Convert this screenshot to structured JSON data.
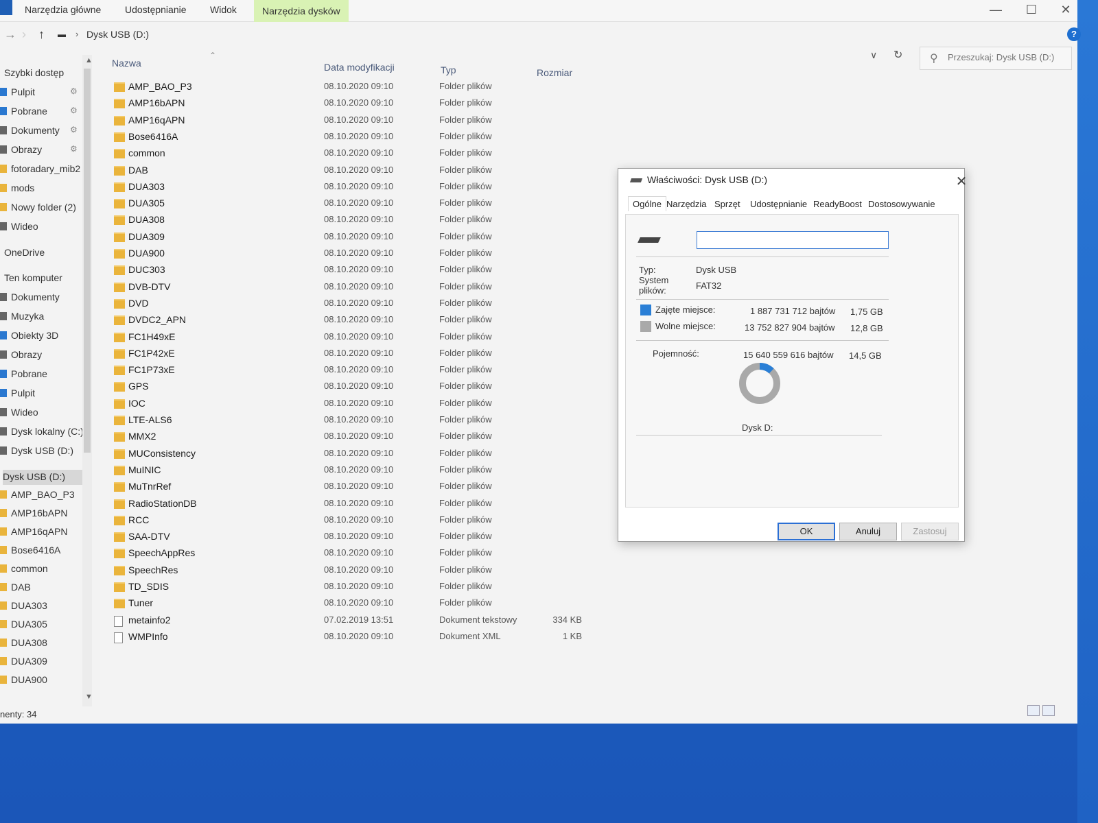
{
  "ribbon": {
    "tabs": [
      "Narzędzia główne",
      "Udostępnianie",
      "Widok"
    ],
    "tools_tab": "Narzędzia dysków"
  },
  "address": {
    "path": "Dysk USB (D:)",
    "search_placeholder": "Przeszukaj: Dysk USB (D:)"
  },
  "nav": {
    "quick_access": "Szybki dostęp",
    "items": [
      {
        "label": "Pulpit",
        "icon": "blue",
        "pinned": true
      },
      {
        "label": "Pobrane",
        "icon": "blue",
        "pinned": true
      },
      {
        "label": "Dokumenty",
        "icon": "grey",
        "pinned": true
      },
      {
        "label": "Obrazy",
        "icon": "grey",
        "pinned": true
      },
      {
        "label": "fotoradary_mib2",
        "icon": "folder",
        "pinned": false
      },
      {
        "label": "mods",
        "icon": "folder",
        "pinned": false
      },
      {
        "label": "Nowy folder (2)",
        "icon": "folder",
        "pinned": false
      },
      {
        "label": "Wideo",
        "icon": "grey",
        "pinned": false
      }
    ],
    "onedrive": "OneDrive",
    "this_pc": "Ten komputer",
    "pc_items": [
      "Dokumenty",
      "Muzyka",
      "Obiekty 3D",
      "Obrazy",
      "Pobrane",
      "Pulpit",
      "Wideo",
      "Dysk lokalny (C:)",
      "Dysk USB (D:)"
    ],
    "usb_root": "Dysk USB (D:)",
    "usb_items": [
      "AMP_BAO_P3",
      "AMP16bAPN",
      "AMP16qAPN",
      "Bose6416A",
      "common",
      "DAB",
      "DUA303",
      "DUA305",
      "DUA308",
      "DUA309",
      "DUA900"
    ]
  },
  "columns": {
    "name": "Nazwa",
    "date": "Data modyfikacji",
    "type": "Typ",
    "size": "Rozmiar"
  },
  "files": [
    {
      "name": "AMP_BAO_P3",
      "date": "08.10.2020 09:10",
      "type": "Folder plików",
      "size": "",
      "kind": "folder"
    },
    {
      "name": "AMP16bAPN",
      "date": "08.10.2020 09:10",
      "type": "Folder plików",
      "size": "",
      "kind": "folder"
    },
    {
      "name": "AMP16qAPN",
      "date": "08.10.2020 09:10",
      "type": "Folder plików",
      "size": "",
      "kind": "folder"
    },
    {
      "name": "Bose6416A",
      "date": "08.10.2020 09:10",
      "type": "Folder plików",
      "size": "",
      "kind": "folder"
    },
    {
      "name": "common",
      "date": "08.10.2020 09:10",
      "type": "Folder plików",
      "size": "",
      "kind": "folder"
    },
    {
      "name": "DAB",
      "date": "08.10.2020 09:10",
      "type": "Folder plików",
      "size": "",
      "kind": "folder"
    },
    {
      "name": "DUA303",
      "date": "08.10.2020 09:10",
      "type": "Folder plików",
      "size": "",
      "kind": "folder"
    },
    {
      "name": "DUA305",
      "date": "08.10.2020 09:10",
      "type": "Folder plików",
      "size": "",
      "kind": "folder"
    },
    {
      "name": "DUA308",
      "date": "08.10.2020 09:10",
      "type": "Folder plików",
      "size": "",
      "kind": "folder"
    },
    {
      "name": "DUA309",
      "date": "08.10.2020 09:10",
      "type": "Folder plików",
      "size": "",
      "kind": "folder"
    },
    {
      "name": "DUA900",
      "date": "08.10.2020 09:10",
      "type": "Folder plików",
      "size": "",
      "kind": "folder"
    },
    {
      "name": "DUC303",
      "date": "08.10.2020 09:10",
      "type": "Folder plików",
      "size": "",
      "kind": "folder"
    },
    {
      "name": "DVB-DTV",
      "date": "08.10.2020 09:10",
      "type": "Folder plików",
      "size": "",
      "kind": "folder"
    },
    {
      "name": "DVD",
      "date": "08.10.2020 09:10",
      "type": "Folder plików",
      "size": "",
      "kind": "folder"
    },
    {
      "name": "DVDC2_APN",
      "date": "08.10.2020 09:10",
      "type": "Folder plików",
      "size": "",
      "kind": "folder"
    },
    {
      "name": "FC1H49xE",
      "date": "08.10.2020 09:10",
      "type": "Folder plików",
      "size": "",
      "kind": "folder"
    },
    {
      "name": "FC1P42xE",
      "date": "08.10.2020 09:10",
      "type": "Folder plików",
      "size": "",
      "kind": "folder"
    },
    {
      "name": "FC1P73xE",
      "date": "08.10.2020 09:10",
      "type": "Folder plików",
      "size": "",
      "kind": "folder"
    },
    {
      "name": "GPS",
      "date": "08.10.2020 09:10",
      "type": "Folder plików",
      "size": "",
      "kind": "folder"
    },
    {
      "name": "IOC",
      "date": "08.10.2020 09:10",
      "type": "Folder plików",
      "size": "",
      "kind": "folder"
    },
    {
      "name": "LTE-ALS6",
      "date": "08.10.2020 09:10",
      "type": "Folder plików",
      "size": "",
      "kind": "folder"
    },
    {
      "name": "MMX2",
      "date": "08.10.2020 09:10",
      "type": "Folder plików",
      "size": "",
      "kind": "folder"
    },
    {
      "name": "MUConsistency",
      "date": "08.10.2020 09:10",
      "type": "Folder plików",
      "size": "",
      "kind": "folder"
    },
    {
      "name": "MuINIC",
      "date": "08.10.2020 09:10",
      "type": "Folder plików",
      "size": "",
      "kind": "folder"
    },
    {
      "name": "MuTnrRef",
      "date": "08.10.2020 09:10",
      "type": "Folder plików",
      "size": "",
      "kind": "folder"
    },
    {
      "name": "RadioStationDB",
      "date": "08.10.2020 09:10",
      "type": "Folder plików",
      "size": "",
      "kind": "folder"
    },
    {
      "name": "RCC",
      "date": "08.10.2020 09:10",
      "type": "Folder plików",
      "size": "",
      "kind": "folder"
    },
    {
      "name": "SAA-DTV",
      "date": "08.10.2020 09:10",
      "type": "Folder plików",
      "size": "",
      "kind": "folder"
    },
    {
      "name": "SpeechAppRes",
      "date": "08.10.2020 09:10",
      "type": "Folder plików",
      "size": "",
      "kind": "folder"
    },
    {
      "name": "SpeechRes",
      "date": "08.10.2020 09:10",
      "type": "Folder plików",
      "size": "",
      "kind": "folder"
    },
    {
      "name": "TD_SDIS",
      "date": "08.10.2020 09:10",
      "type": "Folder plików",
      "size": "",
      "kind": "folder"
    },
    {
      "name": "Tuner",
      "date": "08.10.2020 09:10",
      "type": "Folder plików",
      "size": "",
      "kind": "folder"
    },
    {
      "name": "metainfo2",
      "date": "07.02.2019 13:51",
      "type": "Dokument tekstowy",
      "size": "334 KB",
      "kind": "doc"
    },
    {
      "name": "WMPInfo",
      "date": "08.10.2020 09:10",
      "type": "Dokument XML",
      "size": "1 KB",
      "kind": "doc"
    }
  ],
  "status_text": "nenty: 34",
  "dialog": {
    "title": "Właściwości: Dysk USB (D:)",
    "tabs": [
      "Ogólne",
      "Narzędzia",
      "Sprzęt",
      "Udostępnianie",
      "ReadyBoost",
      "Dostosowywanie"
    ],
    "label_value": "",
    "type_key": "Typ:",
    "type_value": "Dysk USB",
    "fs_key_line1": "System",
    "fs_key_line2": "plików:",
    "fs_value": "FAT32",
    "used_key": "Zajęte miejsce:",
    "used_bytes": "1 887 731 712 bajtów",
    "used_gb": "1,75 GB",
    "free_key": "Wolne miejsce:",
    "free_bytes": "13 752 827 904 bajtów",
    "free_gb": "12,8 GB",
    "capacity_key": "Pojemność:",
    "capacity_bytes": "15 640 559 616 bajtów",
    "capacity_gb": "14,5 GB",
    "drive_label": "Dysk D:",
    "used_fraction": 0.1207,
    "used_color": "#2a7fd6",
    "free_color": "#a9a9a9",
    "ok": "OK",
    "cancel": "Anuluj",
    "apply": "Zastosuj"
  }
}
